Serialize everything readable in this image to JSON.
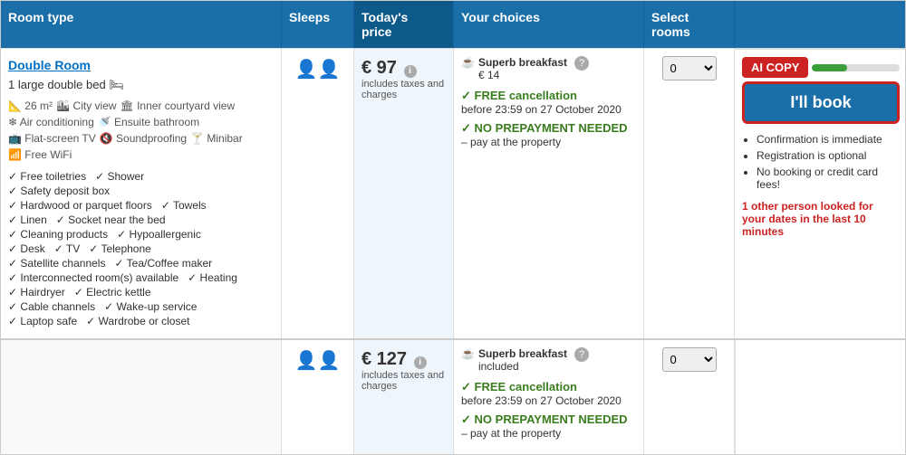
{
  "header": {
    "col1": "Room type",
    "col2": "Sleeps",
    "col3": "Today's price",
    "col4": "Your choices",
    "col5": "Select rooms"
  },
  "room1": {
    "name": "Double Room",
    "bed": "1 large double bed",
    "bed_icon": "🛏",
    "icons": [
      {
        "icon": "📐",
        "label": "26 m²"
      },
      {
        "icon": "🏙",
        "label": "City view"
      },
      {
        "icon": "🏛",
        "label": "Inner courtyard view"
      },
      {
        "icon": "❄",
        "label": "Air conditioning"
      },
      {
        "icon": "🚿",
        "label": "Ensuite bathroom"
      },
      {
        "icon": "📺",
        "label": "Flat-screen TV"
      },
      {
        "icon": "🔇",
        "label": "Soundproofing"
      },
      {
        "icon": "🍸",
        "label": "Minibar"
      },
      {
        "icon": "📶",
        "label": "Free WiFi"
      }
    ],
    "amenities_col1": [
      "Free toiletries",
      "Safety deposit box",
      "Hardwood or parquet floors",
      "Linen",
      "Cleaning products",
      "Desk",
      "Satellite channels",
      "Interconnected room(s) available",
      "Hairdryer",
      "Cable channels",
      "Laptop safe"
    ],
    "amenities_col2": [
      "Shower",
      "",
      "Towels",
      "Socket near the bed",
      "Hypoallergenic",
      "TV • Telephone",
      "Tea/Coffee maker",
      "Heating",
      "Electric kettle",
      "Wake-up service",
      "Wardrobe or closet"
    ],
    "sleeps_icon": "👤👤",
    "price": "€ 97",
    "price_note": "includes taxes and charges",
    "breakfast_icon": "☕",
    "breakfast_label": "Superb breakfast",
    "breakfast_sub": "€ 14",
    "free_cancel": "FREE cancellation",
    "cancel_date": "before 23:59 on 27 October 2020",
    "no_prepay": "NO PREPAYMENT NEEDED",
    "pay_text": "– pay at the property"
  },
  "room2": {
    "sleeps_icon": "👤👤",
    "price": "€ 127",
    "price_note": "includes taxes and charges",
    "breakfast_icon": "☕",
    "breakfast_label": "Superb breakfast",
    "breakfast_sub": "included",
    "free_cancel": "FREE cancellation",
    "cancel_date": "before 23:59 on 27 October 2020",
    "no_prepay": "NO PREPAYMENT NEEDED",
    "pay_text": "– pay at the property"
  },
  "right_panel": {
    "ai_copy": "AI COPY",
    "book_btn": "I'll book",
    "benefits": [
      "Confirmation is immediate",
      "Registration is optional",
      "No booking or credit card fees!"
    ],
    "urgency": "1 other person looked for your dates in the last 10 minutes"
  }
}
